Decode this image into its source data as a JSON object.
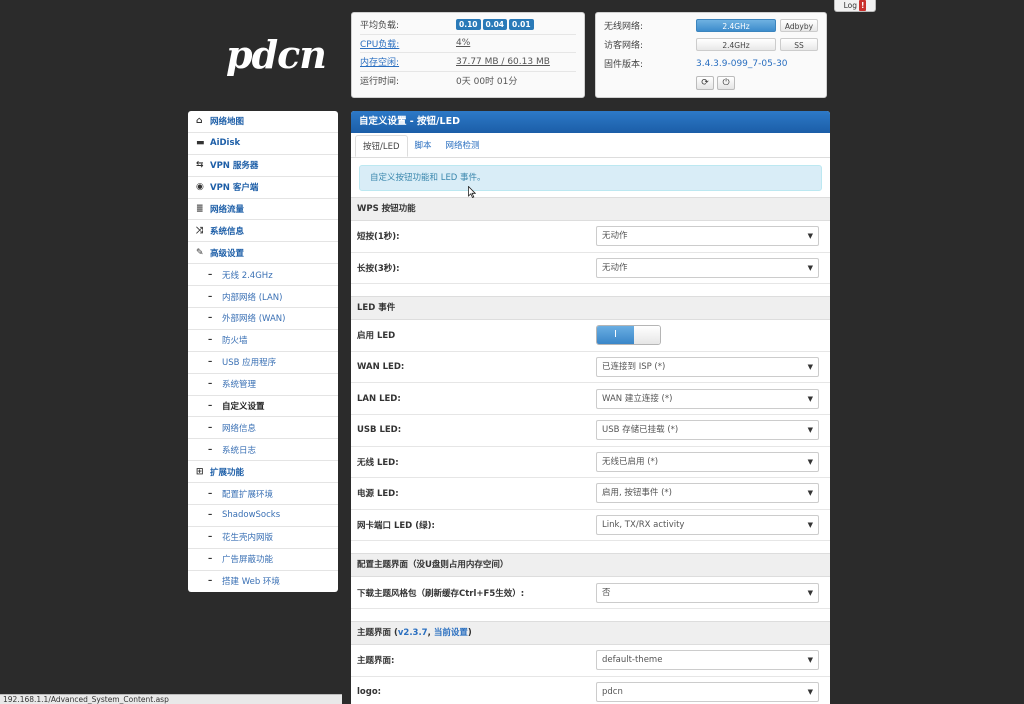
{
  "logo": "pdcn",
  "status": {
    "load_label": "平均负载:",
    "load_values": [
      "0.10",
      "0.04",
      "0.01"
    ],
    "cpu_label": "CPU负载:",
    "cpu_value": "4%",
    "mem_label": "内存空闲:",
    "mem_value": "37.77 MB / 60.13 MB",
    "uptime_label": "运行时间:",
    "uptime_value": "0天 00时 01分"
  },
  "status_right": {
    "wireless_label": "无线网络:",
    "wireless_btn": "2.4GHz",
    "adbyby_btn": "Adbyby",
    "guest_label": "访客网络:",
    "guest_btn": "2.4GHz",
    "ss_btn": "SS",
    "firmware_label": "固件版本:",
    "firmware_value": "3.4.3.9-099_7-05-30"
  },
  "log_button": "Log",
  "log_alert": "!",
  "sidebar": {
    "items": [
      {
        "label": "网络地图",
        "icon": "home-icon",
        "glyph": "⌂"
      },
      {
        "label": "AiDisk",
        "icon": "disk-icon",
        "glyph": "▬"
      },
      {
        "label": "VPN 服务器",
        "icon": "vpn-server-icon",
        "glyph": "⇆"
      },
      {
        "label": "VPN 客户端",
        "icon": "globe-icon",
        "glyph": "◉"
      },
      {
        "label": "网络流量",
        "icon": "list-icon",
        "glyph": "≣"
      },
      {
        "label": "系统信息",
        "icon": "shuffle-icon",
        "glyph": "⤨"
      },
      {
        "label": "高级设置",
        "icon": "wrench-icon",
        "glyph": "✎"
      }
    ],
    "advanced_sub": [
      "无线 2.4GHz",
      "内部网络 (LAN)",
      "外部网络 (WAN)",
      "防火墙",
      "USB 应用程序",
      "系统管理",
      "自定义设置",
      "网络信息",
      "系统日志"
    ],
    "ext_label": "扩展功能",
    "ext_icon": "grid-icon",
    "ext_sub": [
      "配置扩展环境",
      "ShadowSocks",
      "花生壳内网版",
      "广告屏蔽功能",
      "搭建 Web 环境"
    ]
  },
  "content": {
    "title": "自定义设置 - 按钮/LED",
    "tabs": [
      "按钮/LED",
      "脚本",
      "网络检测"
    ],
    "info": "自定义按钮功能和 LED 事件。",
    "wps_section": "WPS 按钮功能",
    "short_press_label": "短按(1秒):",
    "short_press_value": "无动作",
    "long_press_label": "长按(3秒):",
    "long_press_value": "无动作",
    "led_section": "LED 事件",
    "enable_led_label": "启用 LED",
    "enable_led_state": "I",
    "wan_led_label": "WAN LED:",
    "wan_led_value": "已连接到 ISP (*)",
    "lan_led_label": "LAN LED:",
    "lan_led_value": "WAN 建立连接 (*)",
    "usb_led_label": "USB LED:",
    "usb_led_value": "USB 存储已挂载 (*)",
    "wifi_led_label": "无线 LED:",
    "wifi_led_value": "无线已启用 (*)",
    "power_led_label": "电源 LED:",
    "power_led_value": "启用, 按钮事件 (*)",
    "nic_led_label": "网卡端口 LED (绿):",
    "nic_led_value": "Link, TX/RX activity",
    "theme_section": "配置主题界面（没U盘则占用内存空间）",
    "download_theme_label": "下载主题风格包（刷新缓存Ctrl+F5生效）:",
    "download_theme_value": "否",
    "theme_ui_section_prefix": "主题界面 (",
    "theme_ui_version": "v2.3.7",
    "theme_ui_sep": ", ",
    "theme_ui_current": "当前设置",
    "theme_ui_suffix": ")",
    "theme_label": "主题界面:",
    "theme_value": "default-theme",
    "logo_label": "logo:",
    "logo_value": "pdcn"
  },
  "statusbar": "192.168.1.1/Advanced_System_Content.asp",
  "colors": {
    "accent": "#1b5ea8",
    "badge": "#2a7ab8",
    "background": "#2b2b2b"
  }
}
